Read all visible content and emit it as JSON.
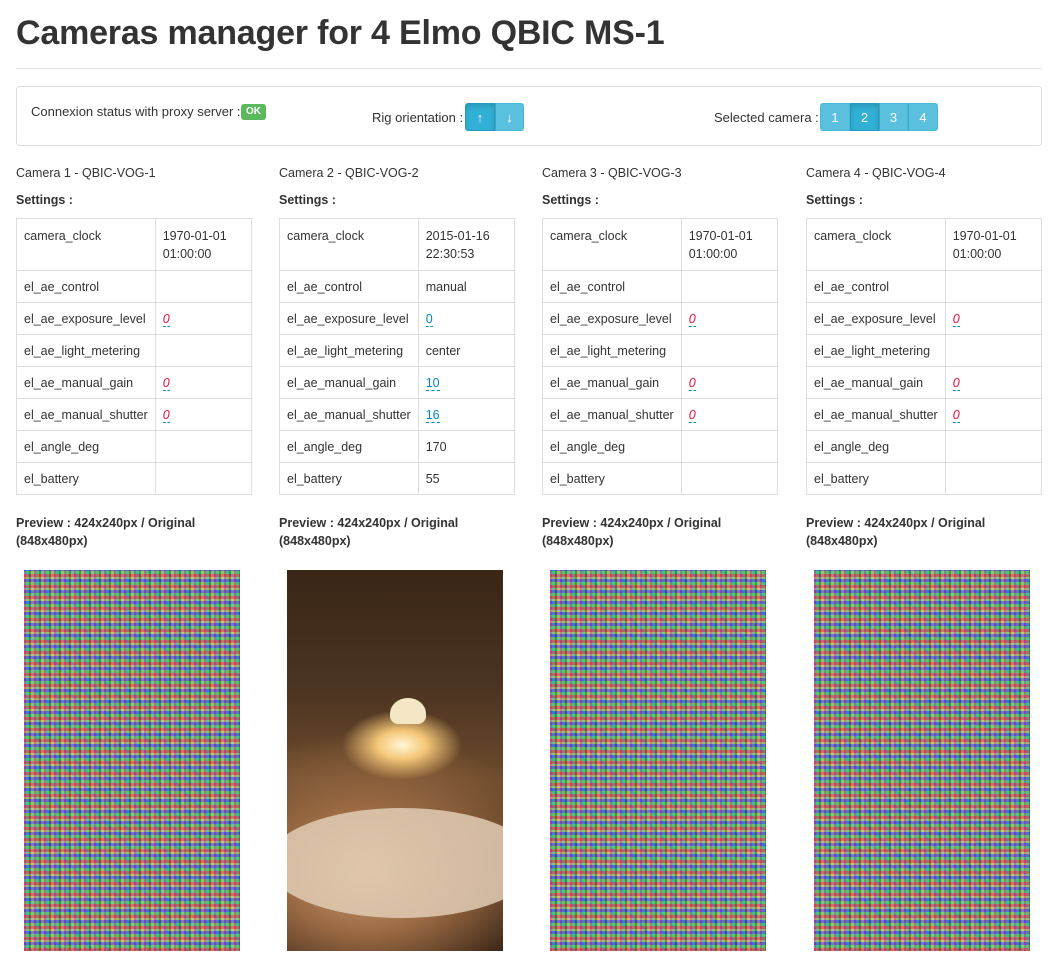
{
  "page": {
    "title": "Cameras manager for 4 Elmo QBIC MS-1"
  },
  "toolbar": {
    "connexion_label": "Connexion status with proxy server :",
    "connexion_status": "OK",
    "orientation_label": "Rig orientation :",
    "orientation_up": "↑",
    "orientation_down": "↓",
    "selected_label": "Selected camera :",
    "camera_buttons": [
      "1",
      "2",
      "3",
      "4"
    ],
    "selected_camera": "2"
  },
  "cameras": [
    {
      "title": "Camera 1 - QBIC-VOG-1",
      "settings_title": "Settings :",
      "settings": [
        {
          "key": "camera_clock",
          "value": "1970-01-01 01:00:00"
        },
        {
          "key": "el_ae_control",
          "value": ""
        },
        {
          "key": "el_ae_exposure_level",
          "value": "0"
        },
        {
          "key": "el_ae_light_metering",
          "value": ""
        },
        {
          "key": "el_ae_manual_gain",
          "value": "0"
        },
        {
          "key": "el_ae_manual_shutter",
          "value": "0"
        },
        {
          "key": "el_angle_deg",
          "value": ""
        },
        {
          "key": "el_battery",
          "value": ""
        }
      ],
      "preview_title": "Preview : 424x240px / Original (848x480px)",
      "preview_kind": "noise"
    },
    {
      "title": "Camera 2 - QBIC-VOG-2",
      "settings_title": "Settings :",
      "settings": [
        {
          "key": "camera_clock",
          "value": "2015-01-16 22:30:53"
        },
        {
          "key": "el_ae_control",
          "value": "manual"
        },
        {
          "key": "el_ae_exposure_level",
          "value": "0"
        },
        {
          "key": "el_ae_light_metering",
          "value": "center"
        },
        {
          "key": "el_ae_manual_gain",
          "value": "10"
        },
        {
          "key": "el_ae_manual_shutter",
          "value": "16"
        },
        {
          "key": "el_angle_deg",
          "value": "170"
        },
        {
          "key": "el_battery",
          "value": "55"
        }
      ],
      "preview_title": "Preview : 424x240px / Original (848x480px)",
      "preview_kind": "photo"
    },
    {
      "title": "Camera 3 - QBIC-VOG-3",
      "settings_title": "Settings :",
      "settings": [
        {
          "key": "camera_clock",
          "value": "1970-01-01 01:00:00"
        },
        {
          "key": "el_ae_control",
          "value": ""
        },
        {
          "key": "el_ae_exposure_level",
          "value": "0"
        },
        {
          "key": "el_ae_light_metering",
          "value": ""
        },
        {
          "key": "el_ae_manual_gain",
          "value": "0"
        },
        {
          "key": "el_ae_manual_shutter",
          "value": "0"
        },
        {
          "key": "el_angle_deg",
          "value": ""
        },
        {
          "key": "el_battery",
          "value": ""
        }
      ],
      "preview_title": "Preview : 424x240px / Original (848x480px)",
      "preview_kind": "noise"
    },
    {
      "title": "Camera 4 - QBIC-VOG-4",
      "settings_title": "Settings :",
      "settings": [
        {
          "key": "camera_clock",
          "value": "1970-01-01 01:00:00"
        },
        {
          "key": "el_ae_control",
          "value": ""
        },
        {
          "key": "el_ae_exposure_level",
          "value": "0"
        },
        {
          "key": "el_ae_light_metering",
          "value": ""
        },
        {
          "key": "el_ae_manual_gain",
          "value": "0"
        },
        {
          "key": "el_ae_manual_shutter",
          "value": "0"
        },
        {
          "key": "el_angle_deg",
          "value": ""
        },
        {
          "key": "el_battery",
          "value": ""
        }
      ],
      "preview_title": "Preview : 424x240px / Original (848x480px)",
      "preview_kind": "noise"
    }
  ],
  "colors": {
    "info_button": "#5bc0de",
    "ok_badge": "#5cb85c",
    "editable_link": "#0088cc",
    "editable_empty": "#dd1144"
  }
}
